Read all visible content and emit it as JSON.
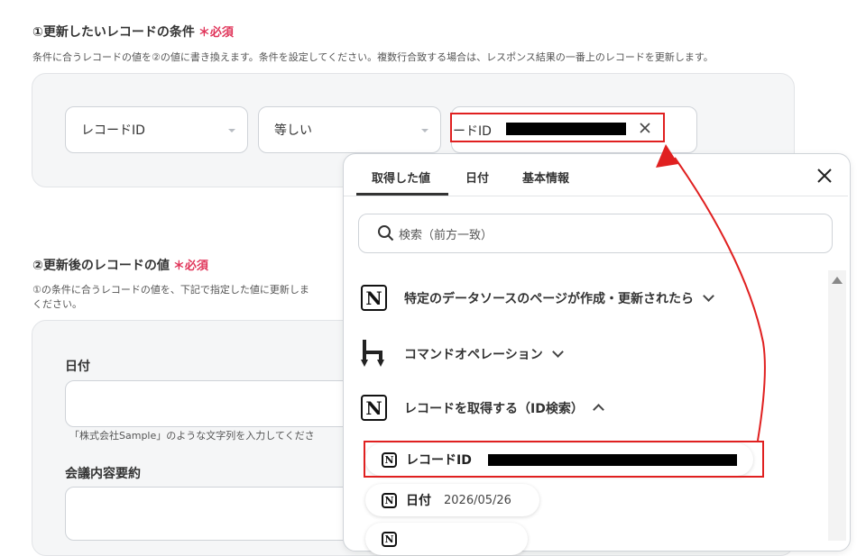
{
  "section1": {
    "title": "①更新したいレコードの条件",
    "required": "＊必須",
    "description": "条件に合うレコードの値を②の値に書き換えます。条件を設定してください。複数行合致する場合は、レスポンス結果の一番上のレコードを更新します。",
    "field_select": "レコードID",
    "operator_select": "等しい",
    "value_text": "ードID"
  },
  "section2": {
    "title": "②更新後のレコードの値",
    "required": "＊必須",
    "description_line1": "①の条件に合うレコードの値を、下記で指定した値に更新しま",
    "description_line2": "ください。",
    "field1_label": "日付",
    "field1_hint": "「株式会社Sample」のような文字列を入力してくださ",
    "field2_label": "会議内容要約"
  },
  "popup": {
    "tabs": [
      "取得した値",
      "日付",
      "基本情報"
    ],
    "active_tab": "取得した値",
    "search_placeholder": "検索（前方一致）",
    "groups": [
      {
        "label": "特定のデータソースのページが作成・更新されたら",
        "icon": "notion-icon",
        "expanded": false
      },
      {
        "label": "コマンドオペレーション",
        "icon": "command-operation-icon",
        "expanded": false
      },
      {
        "label": "レコードを取得する（ID検索）",
        "icon": "notion-icon",
        "expanded": true
      }
    ],
    "items": [
      {
        "label": "レコードID",
        "value": ""
      },
      {
        "label": "日付",
        "value": "2026/05/26"
      }
    ]
  },
  "colors": {
    "required": "#e0355a",
    "annotation": "#e02020",
    "redaction": "#000000"
  },
  "icons": [
    "search-icon",
    "close-icon",
    "clear-icon",
    "notion-icon",
    "command-operation-icon",
    "chevron-down-icon",
    "chevron-up-icon",
    "scroll-up-arrow-icon"
  ]
}
